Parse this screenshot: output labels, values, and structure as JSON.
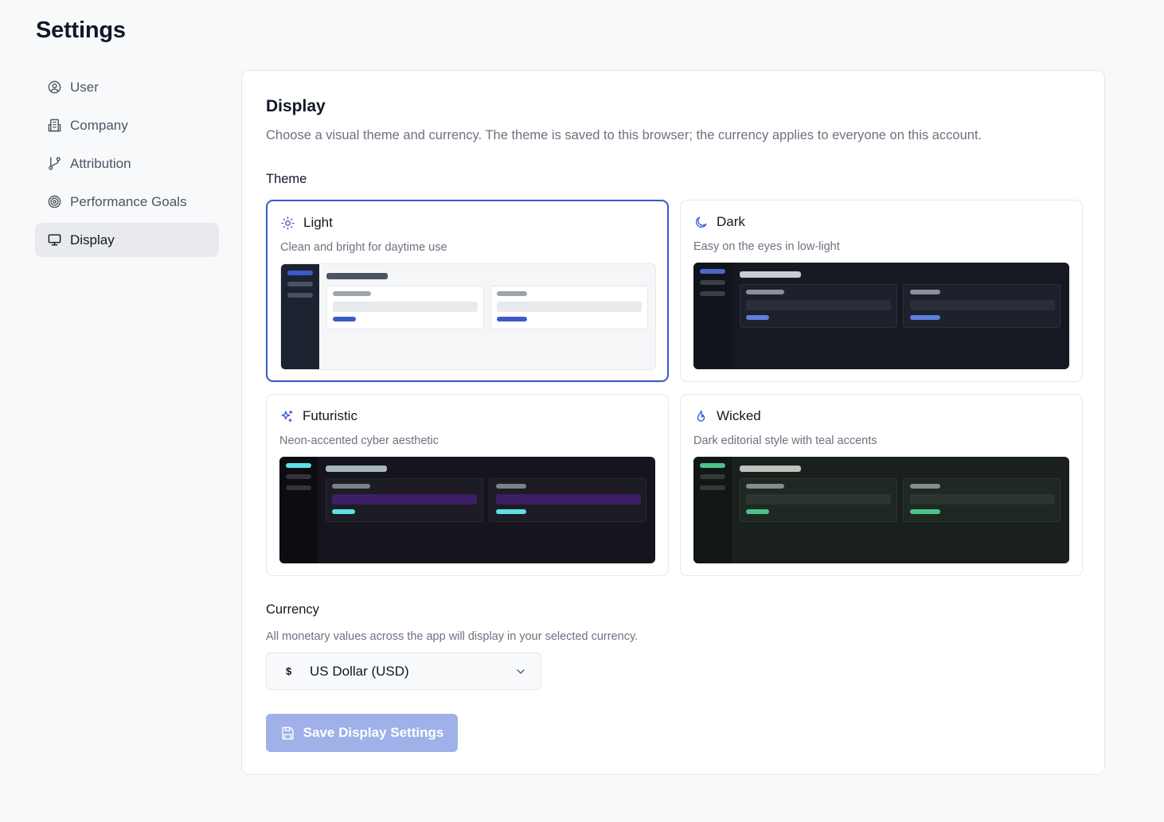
{
  "page": {
    "title": "Settings"
  },
  "sidebar": {
    "items": [
      {
        "label": "User",
        "icon": "user-circle-icon",
        "active": false
      },
      {
        "label": "Company",
        "icon": "building-icon",
        "active": false
      },
      {
        "label": "Attribution",
        "icon": "git-branch-icon",
        "active": false
      },
      {
        "label": "Performance Goals",
        "icon": "target-icon",
        "active": false
      },
      {
        "label": "Display",
        "icon": "monitor-icon",
        "active": true
      }
    ]
  },
  "display": {
    "title": "Display",
    "description": "Choose a visual theme and currency. The theme is saved to this browser; the currency applies to everyone on this account.",
    "theme_label": "Theme",
    "themes": [
      {
        "name": "Light",
        "description": "Clean and bright for daytime use",
        "icon": "sun-icon",
        "selected": true
      },
      {
        "name": "Dark",
        "description": "Easy on the eyes in low-light",
        "icon": "moon-icon",
        "selected": false
      },
      {
        "name": "Futuristic",
        "description": "Neon-accented cyber aesthetic",
        "icon": "sparkles-icon",
        "selected": false
      },
      {
        "name": "Wicked",
        "description": "Dark editorial style with teal accents",
        "icon": "flame-icon",
        "selected": false
      }
    ],
    "currency_label": "Currency",
    "currency_description": "All monetary values across the app will display in your selected currency.",
    "currency_select": {
      "symbol": "$",
      "value": "US Dollar (USD)"
    },
    "save_label": "Save Display Settings"
  },
  "colors": {
    "accent": "#3b5bcc",
    "save_button_disabled": "#9fb1e8",
    "light_accent": "#3b5bcc",
    "dark_accent": "#5b7fe0",
    "futuristic_accent": "#5de0e6",
    "futuristic_fill": "#3d1f66",
    "wicked_accent": "#4ac48a"
  }
}
